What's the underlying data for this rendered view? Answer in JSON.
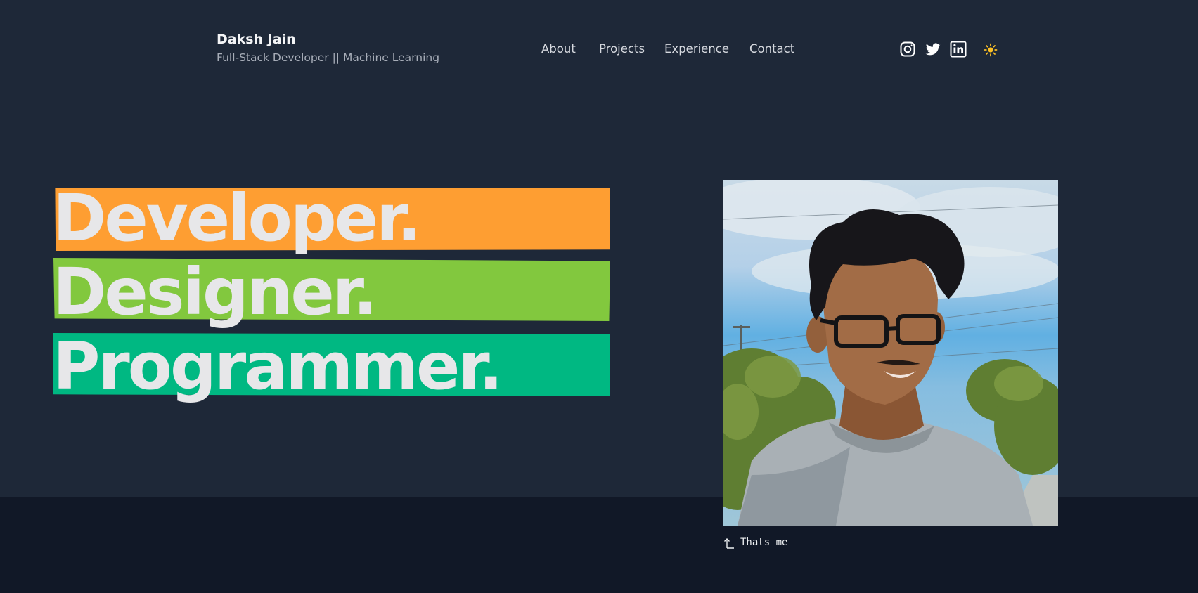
{
  "header": {
    "name": "Daksh Jain",
    "tagline": "Full-Stack Developer || Machine Learning",
    "nav": [
      "About",
      "Projects",
      "Experience",
      "Contact"
    ],
    "social_icons": [
      "instagram-icon",
      "twitter-icon",
      "linkedin-icon"
    ],
    "theme_icon": "sun-icon"
  },
  "hero": {
    "words": [
      "Developer.",
      "Designer.",
      "Programmer."
    ],
    "band_colors": [
      "#fe9e32",
      "#82c83e",
      "#00b882"
    ],
    "text_color": "#e7e7e9"
  },
  "photo": {
    "caption": "Thats me"
  },
  "colors": {
    "background": "#1e2838",
    "footer_background": "#111827",
    "theme_icon": "#fbbf24"
  }
}
